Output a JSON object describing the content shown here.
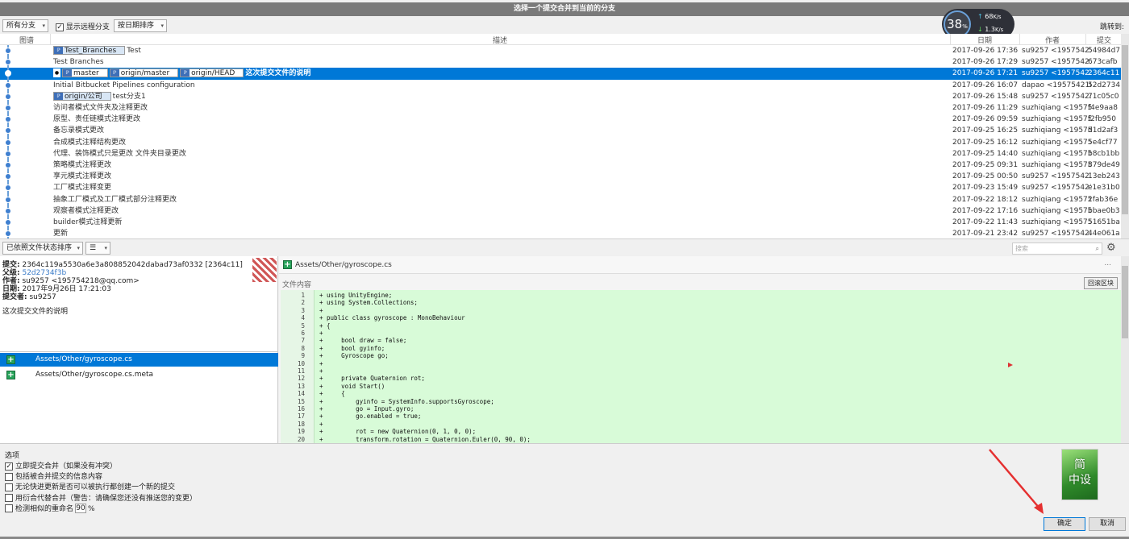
{
  "window": {
    "title": "选择一个提交合并到当前的分支"
  },
  "toolbar": {
    "branch_filter": "所有分支",
    "show_remote_label": "显示远程分支",
    "show_remote_checked": true,
    "sort": "按日期排序",
    "jump_to": "跳转到:"
  },
  "net_monitor": {
    "percent": "38",
    "percent_unit": "%",
    "up": "68",
    "up_unit": "K/s",
    "down": "1.3",
    "down_unit": "K/s"
  },
  "columns": {
    "graph": "图谱",
    "description": "描述",
    "date": "日期",
    "author": "作者",
    "commit": "提交"
  },
  "commits": [
    {
      "tags": [
        {
          "name": "Test_Branches"
        }
      ],
      "desc": "Test",
      "date": "2017-09-26 17:36",
      "author": "su9257 <195754218@qq.com>",
      "hash": "54984d7"
    },
    {
      "tags": [],
      "desc": "Test Branches",
      "date": "2017-09-26 17:29",
      "author": "su9257 <195754218@qq.com>",
      "hash": "673cafb"
    },
    {
      "tags": [
        {
          "name": "master"
        },
        {
          "name": "origin/master"
        },
        {
          "name": "origin/HEAD"
        }
      ],
      "desc": "这次提交文件的说明",
      "date": "2017-09-26 17:21",
      "author": "su9257 <195754218@qq.com>",
      "hash": "2364c11",
      "selected": true
    },
    {
      "tags": [],
      "desc": "Initial Bitbucket Pipelines configuration",
      "date": "2017-09-26 16:07",
      "author": "dapao <195754218@qq.com>",
      "hash": "52d2734"
    },
    {
      "tags": [
        {
          "name": "origin/公司"
        }
      ],
      "desc": "test分支1",
      "date": "2017-09-26 15:48",
      "author": "su9257 <195754218@qq.com>",
      "hash": "71c05c0"
    },
    {
      "tags": [],
      "desc": "访问者模式文件夹及注释更改",
      "date": "2017-09-26 11:29",
      "author": "suzhiqiang <195754218@qq.com>",
      "hash": "f4e9aa8"
    },
    {
      "tags": [],
      "desc": "原型、责任链模式注释更改",
      "date": "2017-09-26 09:59",
      "author": "suzhiqiang <195754218@qq.com>",
      "hash": "f2fb950"
    },
    {
      "tags": [],
      "desc": "备忘录模式更改",
      "date": "2017-09-25 16:25",
      "author": "suzhiqiang <195754218@qq.com>",
      "hash": "d1d2af3"
    },
    {
      "tags": [],
      "desc": "合成模式注释结构更改",
      "date": "2017-09-25 16:12",
      "author": "suzhiqiang <195754218@qq.com>",
      "hash": "5e4cf77"
    },
    {
      "tags": [],
      "desc": "代理、装饰模式只是更改 文件夹目录更改",
      "date": "2017-09-25 14:40",
      "author": "suzhiqiang <195754218@qq.com>",
      "hash": "b8cb1bb"
    },
    {
      "tags": [],
      "desc": "策略模式注释更改",
      "date": "2017-09-25 09:31",
      "author": "suzhiqiang <195754218@qq.com>",
      "hash": "879de49"
    },
    {
      "tags": [],
      "desc": "享元模式注释更改",
      "date": "2017-09-25 00:50",
      "author": "su9257 <195754218@qq.com>",
      "hash": "13eb243"
    },
    {
      "tags": [],
      "desc": "工厂模式注释变更",
      "date": "2017-09-23 15:49",
      "author": "su9257 <195754218@qq.com>",
      "hash": "e1e31b0"
    },
    {
      "tags": [],
      "desc": "抽象工厂模式及工厂模式部分注释更改",
      "date": "2017-09-22 18:12",
      "author": "suzhiqiang <195754218@qq.com>",
      "hash": "2fab36e"
    },
    {
      "tags": [],
      "desc": "观察者模式注释更改",
      "date": "2017-09-22 17:16",
      "author": "suzhiqiang <195754218@qq.com>",
      "hash": "bbae0b3"
    },
    {
      "tags": [],
      "desc": "builder模式注释更新",
      "date": "2017-09-22 11:43",
      "author": "suzhiqiang <195754218@qq.com>",
      "hash": "51651ba"
    },
    {
      "tags": [],
      "desc": "更新",
      "date": "2017-09-21 23:42",
      "author": "su9257 <195754218@qq.com>",
      "hash": "44e061a"
    }
  ],
  "file_bar": {
    "sort": "已依照文件状态排序",
    "view_icon": "list-icon",
    "search_placeholder": "搜索"
  },
  "commit_info": {
    "commit_label": "提交:",
    "commit_value": "2364c119a5530a6e3a808852042dabad73af0332 [2364c11]",
    "parent_label": "父级:",
    "parent_value": "52d2734f3b",
    "author_label": "作者:",
    "author_value": "su9257 <195754218@qq.com>",
    "date_label": "日期:",
    "date_value": "2017年9月26日 17:21:03",
    "committer_label": "提交者:",
    "committer_value": "su9257",
    "message": "这次提交文件的说明"
  },
  "files": [
    {
      "name": "Assets/Other/gyroscope.cs",
      "selected": true
    },
    {
      "name": "Assets/Other/gyroscope.cs.meta",
      "selected": false
    }
  ],
  "diff": {
    "file": "Assets/Other/gyroscope.cs",
    "more": "...",
    "content_label": "文件内容",
    "hunk_button": "回滚区块",
    "lines": [
      "+ using UnityEngine;",
      "+ using System.Collections;",
      "+",
      "+ public class gyroscope : MonoBehaviour",
      "+ {",
      "+",
      "+     bool draw = false;",
      "+     bool gyinfo;",
      "+     Gyroscope go;",
      "+",
      "+",
      "+     private Quaternion rot;",
      "+     void Start()",
      "+     {",
      "+         gyinfo = SystemInfo.supportsGyroscope;",
      "+         go = Input.gyro;",
      "+         go.enabled = true;",
      "+",
      "+         rot = new Quaternion(0, 1, 0, 0);",
      "+         transform.rotation = Quaternion.Euler(0, 90, 0);"
    ]
  },
  "options": {
    "title": "选项",
    "items": [
      {
        "label": "立即提交合并（如果没有冲突）",
        "checked": true
      },
      {
        "label": "包括被合并提交的信息内容",
        "checked": false
      },
      {
        "label": "无论快进更新是否可以被执行都创建一个新的提交",
        "checked": false
      },
      {
        "label": "用衍合代替合并（警告：请确保您还没有推送您的变更）",
        "checked": false
      },
      {
        "label": "检测相似的重命名",
        "checked": false
      }
    ],
    "rename_threshold": "90",
    "rename_unit": "%"
  },
  "logo": {
    "line1": "简",
    "line2": "中设"
  },
  "buttons": {
    "ok": "确定",
    "cancel": "取消"
  },
  "colors": {
    "selection": "#0078d7",
    "diff_added": "#d8fbd8",
    "annotation_arrow": "#e53030"
  }
}
